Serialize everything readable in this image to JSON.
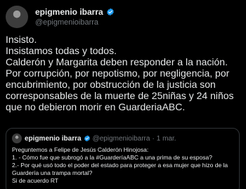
{
  "author": {
    "name": "epigmenio ibarra",
    "handle": "@epigmenioibarra"
  },
  "tweet": {
    "text": "Insisto.\nInsistamos todas y todos.\nCalderón y Margarita deben responder a la nación.\nPor corrupción, por nepotismo, por negligencia, por encubrimiento, por obstrucción de la justicia son corresponsables de la muerte de 25niñas y 24 niños que no debieron morir en GuarderiaABC."
  },
  "quote": {
    "name": "epigmenio ibarra",
    "handle": "@epigmenioibarra",
    "separator": "·",
    "date": "1 mar.",
    "text": "Preguntemos a Felipe de Jesús Calderón Hinojosa:\n1. - Cómo fue que subrogó a la #GuarderíaABC a una prima de su esposa?\n2.- Por qué usó todo el poder del estado para proteger a esa mujer que hizo  de la Guardería una trampa mortal?\nSi de acuerdo RT"
  },
  "colors": {
    "background": "#000000",
    "text": "#e7e9ea",
    "secondary": "#71767b",
    "border": "#2f3336",
    "verified": "#1d9bf0"
  }
}
